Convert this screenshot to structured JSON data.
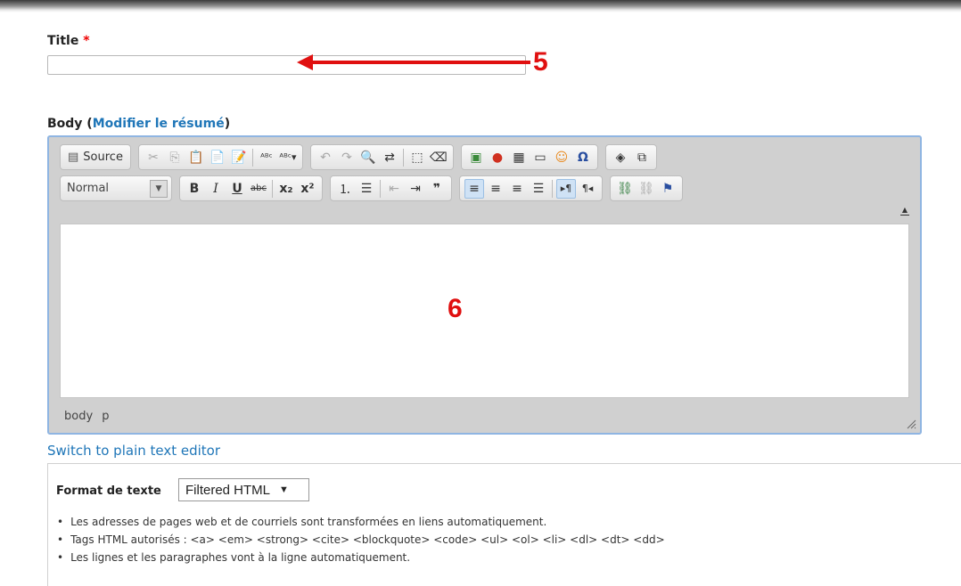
{
  "title_field": {
    "label": "Title",
    "required_marker": "*",
    "value": ""
  },
  "annotations": {
    "title_number": "5",
    "body_number": "6"
  },
  "body_field": {
    "label_prefix": "Body (",
    "summary_link": "Modifier le résumé",
    "label_suffix": ")"
  },
  "editor": {
    "source_label": "Source",
    "format_value": "Normal",
    "path": [
      "body",
      "p"
    ],
    "content": ""
  },
  "switch_editor_link": "Switch to plain text editor",
  "text_format": {
    "label": "Format de texte",
    "selected": "Filtered HTML",
    "tips": [
      "Les adresses de pages web et de courriels sont transformées en liens automatiquement.",
      "Tags HTML autorisés : <a> <em> <strong> <cite> <blockquote> <code> <ul> <ol> <li> <dl> <dt> <dd>",
      "Les lignes et les paragraphes vont à la ligne automatiquement."
    ]
  },
  "colors": {
    "annotation": "#e01010",
    "link": "#1f76b8",
    "required": "#ee0000",
    "editor_border": "#8fb5e2"
  }
}
